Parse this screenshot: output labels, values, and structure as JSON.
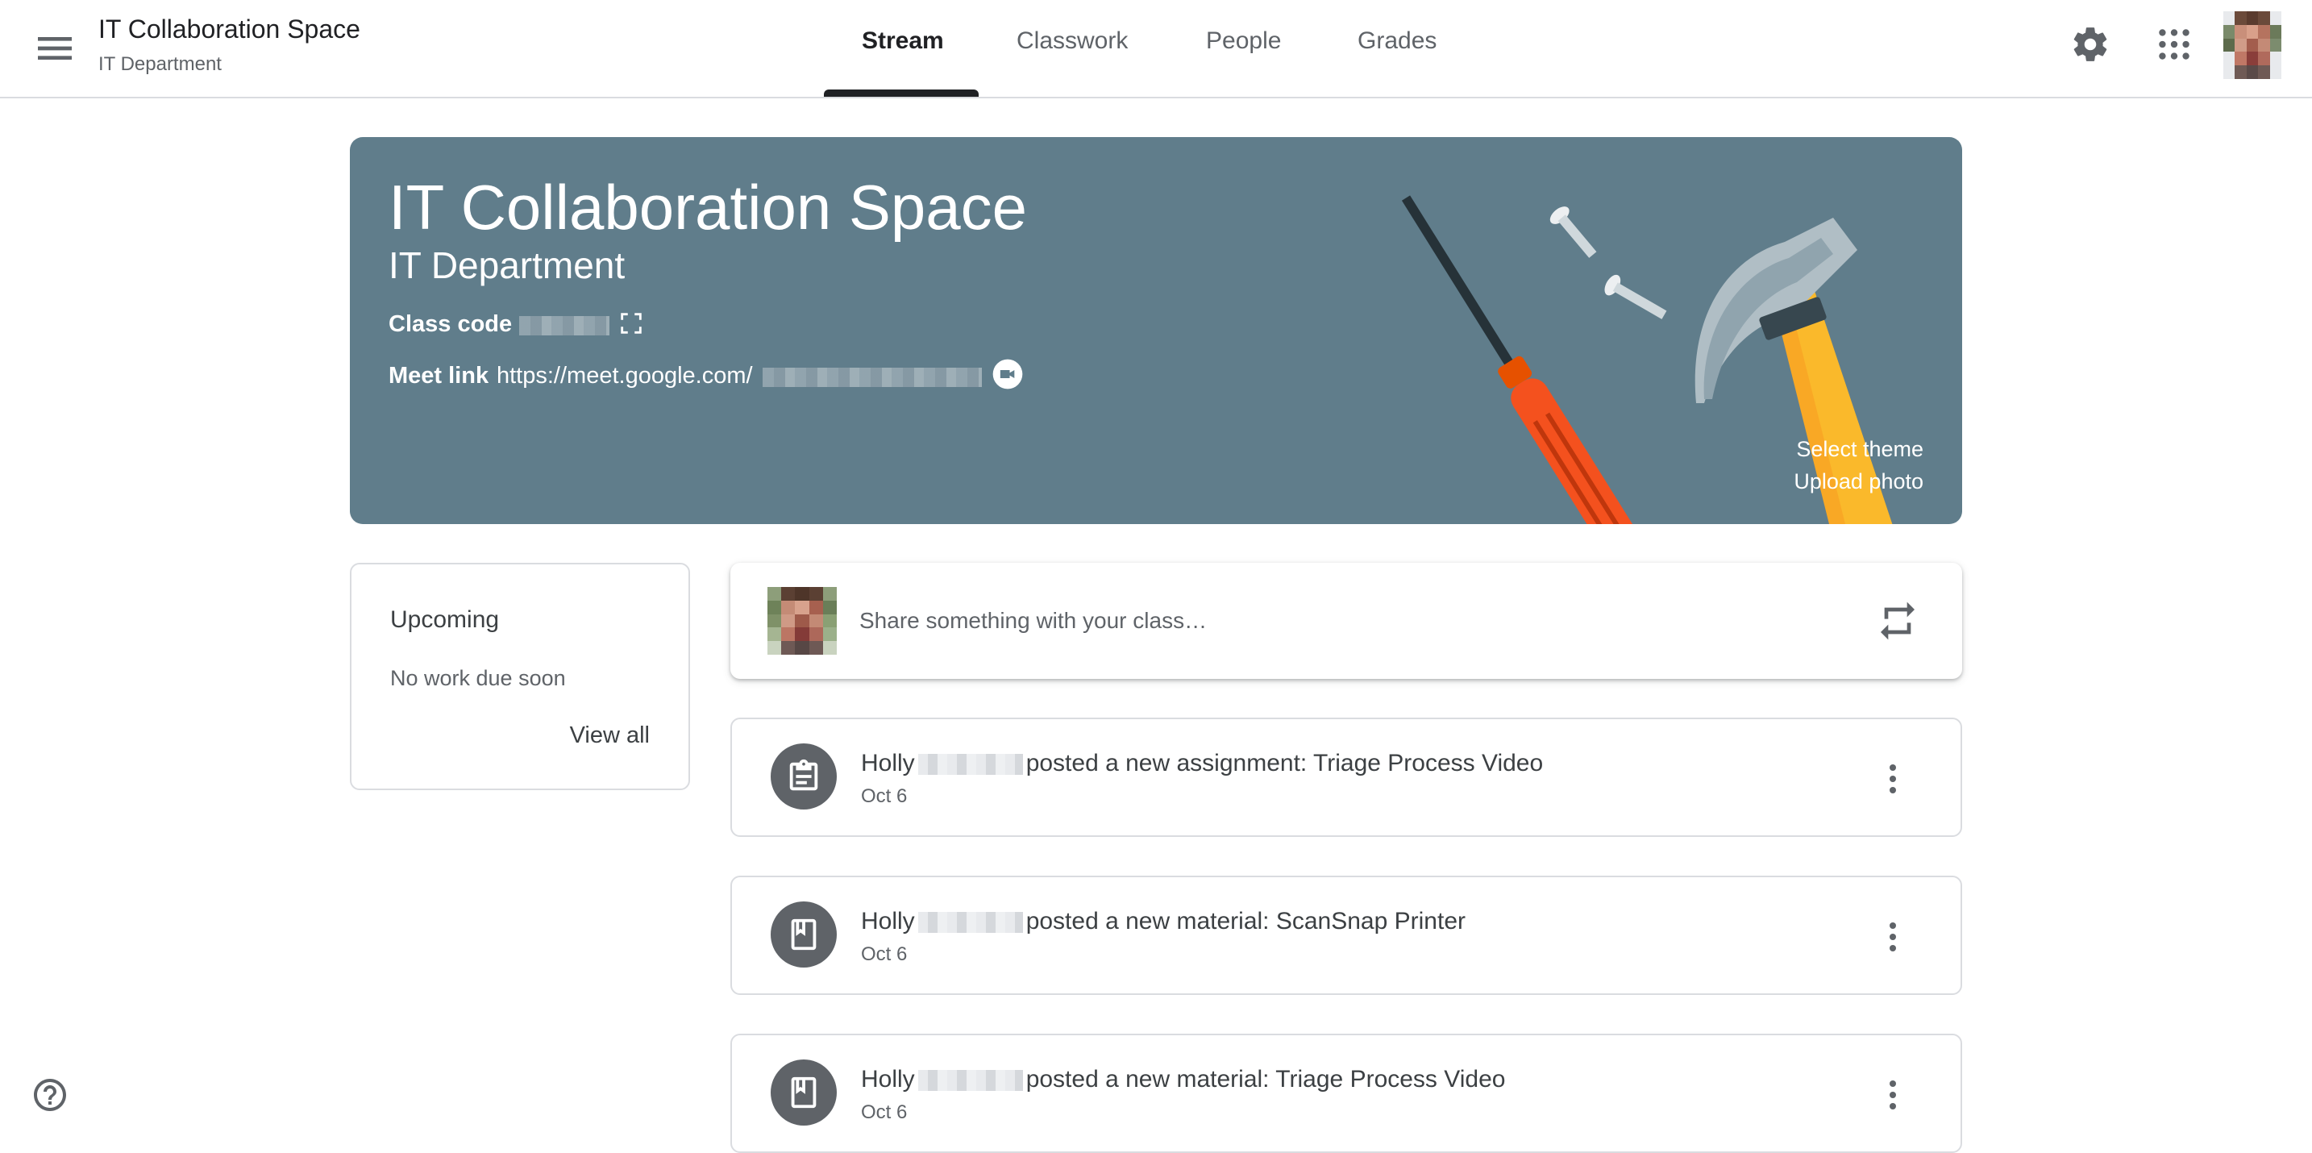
{
  "header": {
    "title": "IT Collaboration Space",
    "subtitle": "IT Department",
    "tabs": [
      {
        "label": "Stream",
        "active": true
      },
      {
        "label": "Classwork",
        "active": false
      },
      {
        "label": "People",
        "active": false
      },
      {
        "label": "Grades",
        "active": false
      }
    ],
    "icons": [
      "menu-icon",
      "gear-icon",
      "apps-grid-icon",
      "avatar"
    ]
  },
  "banner": {
    "title": "IT Collaboration Space",
    "subtitle": "IT Department",
    "class_code_label": "Class code",
    "meet_link_label": "Meet link",
    "meet_link_value": "https://meet.google.com/",
    "select_theme": "Select theme",
    "upload_photo": "Upload photo",
    "background_color": "#607d8b"
  },
  "upcoming": {
    "title": "Upcoming",
    "empty_text": "No work due soon",
    "view_all": "View all"
  },
  "share": {
    "placeholder": "Share something with your class…"
  },
  "posts": [
    {
      "author": "Holly",
      "action": "posted a new assignment: Triage Process Video",
      "date": "Oct 6",
      "icon": "assignment-icon"
    },
    {
      "author": "Holly",
      "action": "posted a new material: ScanSnap Printer",
      "date": "Oct 6",
      "icon": "material-icon"
    },
    {
      "author": "Holly",
      "action": "posted a new material: Triage Process Video",
      "date": "Oct 6",
      "icon": "material-icon"
    }
  ]
}
